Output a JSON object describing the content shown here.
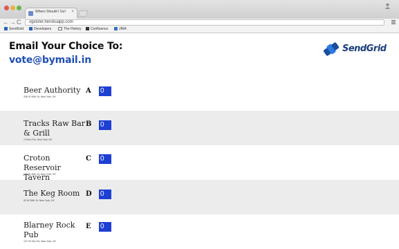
{
  "browser": {
    "tab_title": "Where Should I Go!",
    "tab_close": "×",
    "url": "vgeister.herokuapp.com",
    "nav": {
      "back": "←",
      "forward": "→",
      "reload": "C"
    },
    "bookmarks": [
      "SendGrid",
      "Developers",
      "The History",
      "Confluence",
      "JIRA"
    ]
  },
  "header": {
    "heading": "Email Your Choice To:",
    "email": "vote@bymail.in",
    "brand_name": "SendGrid",
    "brand_color": "#1a3d7c"
  },
  "venues": [
    {
      "name": "Beer Authority",
      "address": "336 W 40th St, New York, NY",
      "letter": "A",
      "count": "0"
    },
    {
      "name": "Tracks Raw Bar & Grill",
      "address": "1 Penn Plz, New York, NY",
      "letter": "B",
      "count": "0"
    },
    {
      "name": "Croton Reservoir Tavern",
      "address": "108 W 40th St, New York, NY",
      "letter": "C",
      "count": "0"
    },
    {
      "name": "The Keg Room",
      "address": "53 W 36th St, New York, NY",
      "letter": "D",
      "count": "0"
    },
    {
      "name": "Blarney Rock Pub",
      "address": "137 W 33rd St, New York, NY",
      "letter": "E",
      "count": "0"
    }
  ],
  "colors": {
    "count_badge": "#1e3fd4",
    "row_shade": "#ececec",
    "email_link": "#1f4fb5"
  }
}
